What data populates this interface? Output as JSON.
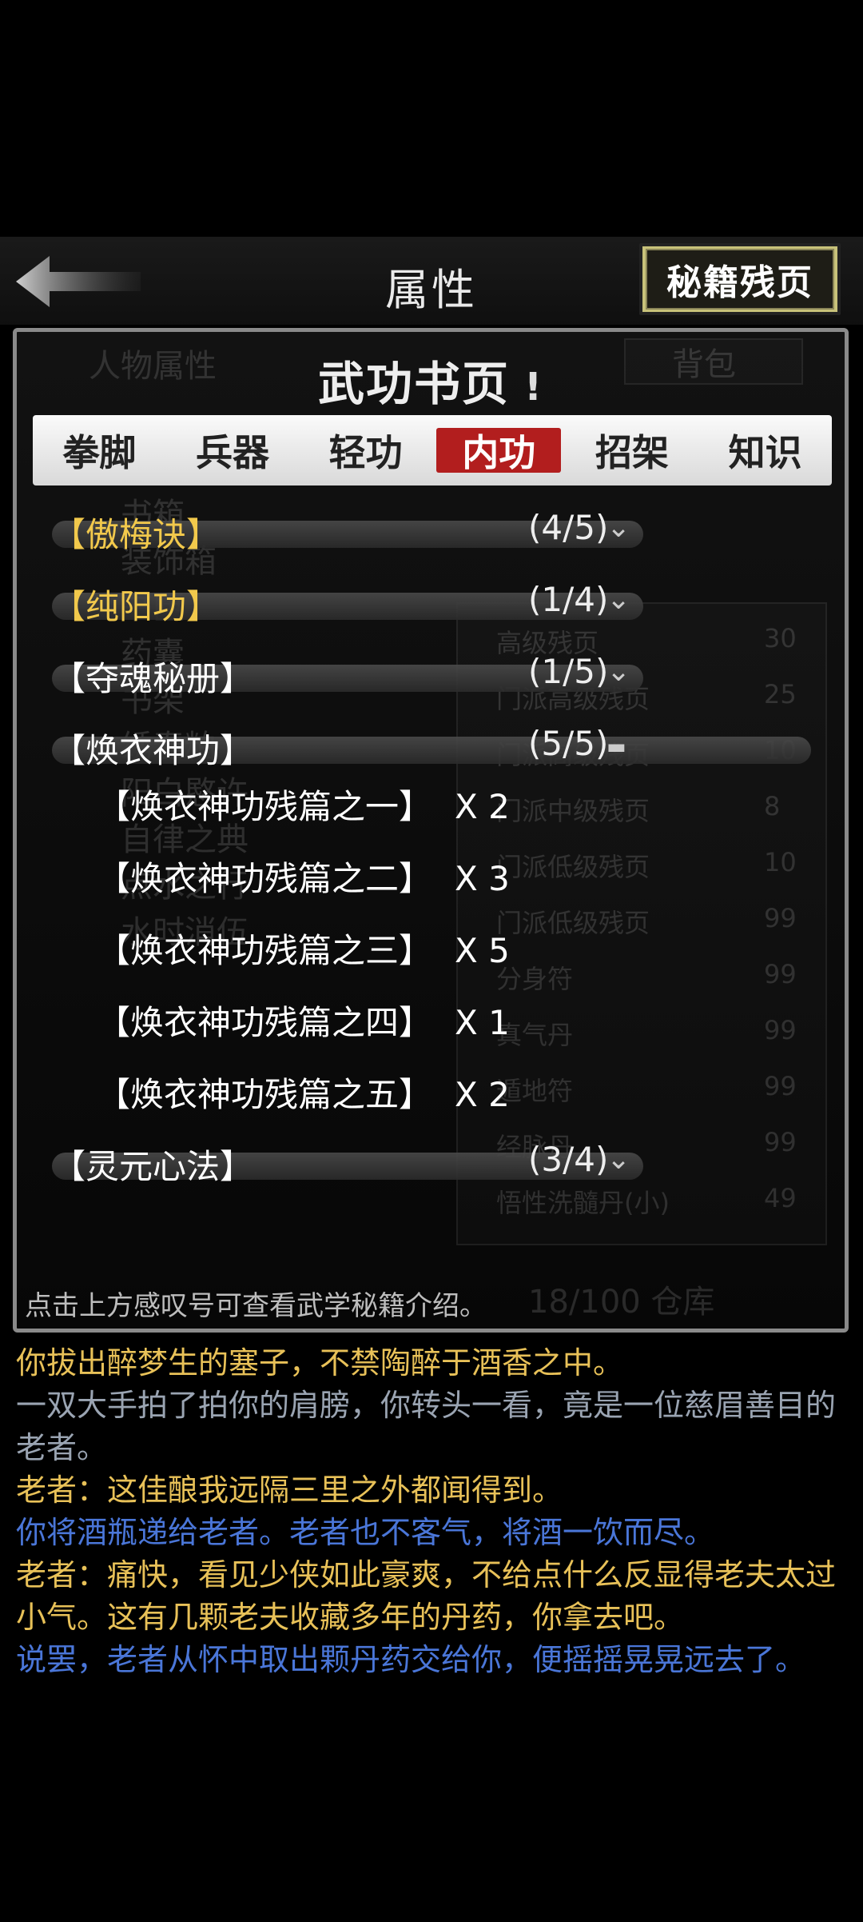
{
  "header": {
    "title": "属性",
    "fragments_button": "秘籍残页"
  },
  "background_screen": {
    "left_tab": "人物属性",
    "right_tab": "背包",
    "items_left": [
      "书箱",
      "装饰箱",
      "书匣",
      "药囊",
      "书架",
      "绣春粕",
      "阳白愍许",
      "自律之典",
      "点水之行",
      "水时消伍"
    ],
    "items_right": [
      {
        "name": "高级残页",
        "count": "30"
      },
      {
        "name": "门派高级残页",
        "count": "25"
      },
      {
        "name": "门派高级残页",
        "count": "10"
      },
      {
        "name": "门派中级残页",
        "count": "8"
      },
      {
        "name": "门派低级残页",
        "count": "10"
      },
      {
        "name": "门派低级残页",
        "count": "99"
      },
      {
        "name": "分身符",
        "count": "99"
      },
      {
        "name": "真气丹",
        "count": "99"
      },
      {
        "name": "遁地符",
        "count": "99"
      },
      {
        "name": "经脉丹",
        "count": "99"
      },
      {
        "name": "悟性洗髓丹(小)",
        "count": "49"
      }
    ],
    "storage": "18/100 仓库"
  },
  "panel": {
    "title": "武功书页",
    "info_mark": "!",
    "hint": "点击上方感叹号可查看武学秘籍介绍。"
  },
  "tabs": [
    {
      "label": "拳脚",
      "active": false
    },
    {
      "label": "兵器",
      "active": false
    },
    {
      "label": "轻功",
      "active": false
    },
    {
      "label": "内功",
      "active": true
    },
    {
      "label": "招架",
      "active": false
    },
    {
      "label": "知识",
      "active": false
    }
  ],
  "skills": [
    {
      "name": "【傲梅诀】",
      "progress": "(4/5)",
      "color": "#f2c94c",
      "expanded": false
    },
    {
      "name": "【纯阳功】",
      "progress": "(1/4)",
      "color": "#f2c94c",
      "expanded": false
    },
    {
      "name": "【夺魂秘册】",
      "progress": "(1/5)",
      "color": "#ffffff",
      "expanded": false
    },
    {
      "name": "【焕衣神功】",
      "progress": "(5/5)",
      "color": "#ffffff",
      "expanded": true
    },
    {
      "name": "【灵元心法】",
      "progress": "(3/4)",
      "color": "#ffffff",
      "expanded": false
    }
  ],
  "fragments": [
    {
      "name": "【焕衣神功残篇之一】",
      "qty": "X 2"
    },
    {
      "name": "【焕衣神功残篇之二】",
      "qty": "X 3"
    },
    {
      "name": "【焕衣神功残篇之三】",
      "qty": "X 5"
    },
    {
      "name": "【焕衣神功残篇之四】",
      "qty": "X 1"
    },
    {
      "name": "【焕衣神功残篇之五】",
      "qty": "X 2"
    }
  ],
  "log": [
    {
      "text": "你拔出醉梦生的塞子，不禁陶醉于酒香之中。",
      "color": "#e8c158"
    },
    {
      "text": "一双大手拍了拍你的肩膀，你转头一看，竟是一位慈眉善目的老者。",
      "color": "#9aa4b2"
    },
    {
      "text": "老者：这佳酿我远隔三里之外都闻得到。",
      "color": "#e8c158"
    },
    {
      "text": "你将酒瓶递给老者。老者也不客气，将酒一饮而尽。",
      "color": "#4a76d8"
    },
    {
      "text": "老者：痛快，看见少侠如此豪爽，不给点什么反显得老夫太过小气。这有几颗老夫收藏多年的丹药，你拿去吧。",
      "color": "#e8c158"
    },
    {
      "text": "说罢，老者从怀中取出颗丹药交给你，便摇摇晃晃远去了。",
      "color": "#4a76d8"
    }
  ],
  "icons": {
    "back": "back-arrow-icon",
    "collapsed": "chevron-down-icon",
    "expanded": "minus-icon"
  }
}
